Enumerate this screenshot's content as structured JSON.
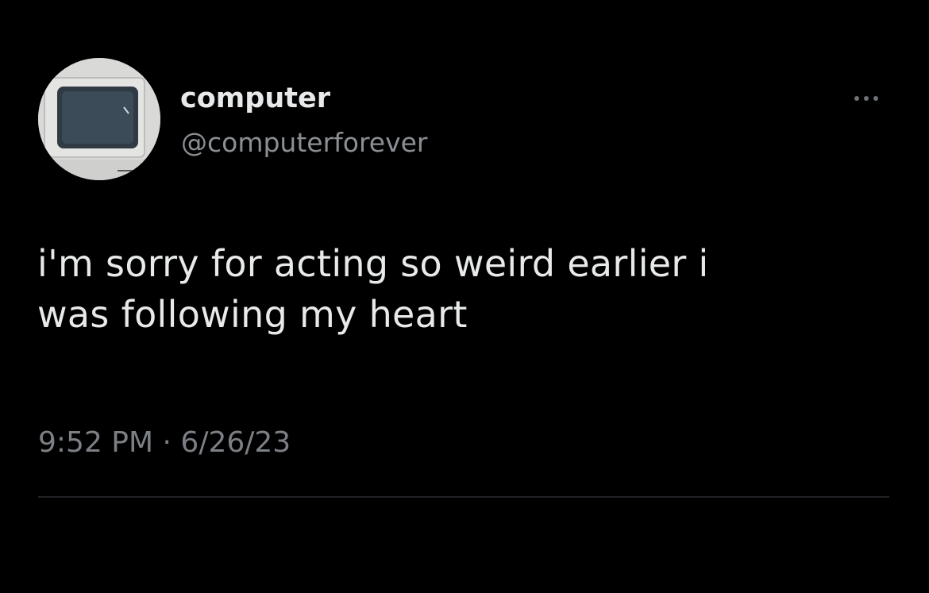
{
  "tweet": {
    "author": {
      "display_name": "computer",
      "handle": "@computerforever",
      "avatar_icon": "old-computer-monitor-icon"
    },
    "more_icon": "more-horizontal-icon",
    "text_lines": [
      "i'm sorry for acting so weird earlier i",
      "was following my heart"
    ],
    "time": "9:52 PM",
    "separator": "·",
    "date": "6/26/23"
  },
  "colors": {
    "background": "#000000",
    "primary_text": "#e7e9ea",
    "secondary_text": "#8b8f94",
    "divider": "#202225"
  }
}
